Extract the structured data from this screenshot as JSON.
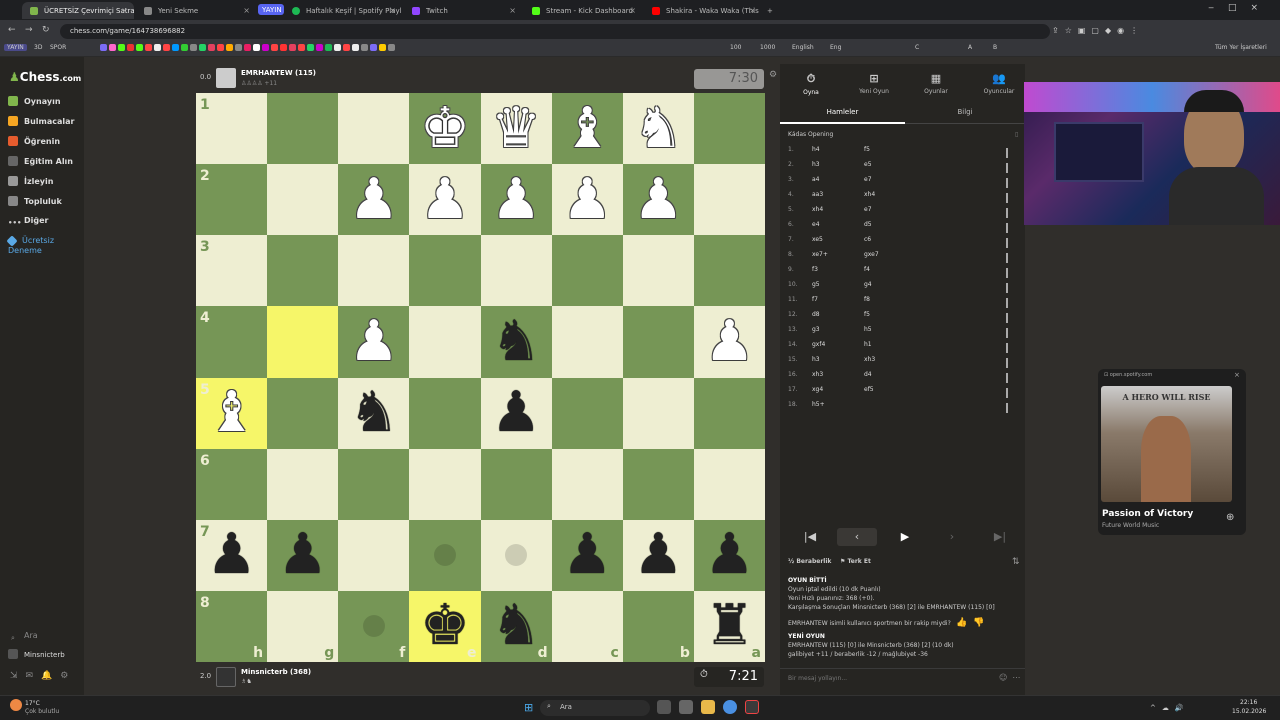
{
  "browser": {
    "tabs": [
      {
        "label": "ÜCRETSİZ Çevrimiçi Satran",
        "active": true
      },
      {
        "label": "Yeni Sekme"
      },
      {
        "label": "YAYIN"
      },
      {
        "label": "Haftalık Keşif | Spotify Playl"
      },
      {
        "label": "Twitch"
      },
      {
        "label": "Stream - Kick Dashboard"
      },
      {
        "label": "Shakira - Waka Waka (This"
      }
    ],
    "url": "chess.com/game/164738696882",
    "bookmarks": [
      "YAYIN",
      "3D",
      "SPOR",
      "100",
      "1000",
      "English",
      "Eng",
      "C",
      "A",
      "B",
      "Tüm Yer İşaretleri"
    ]
  },
  "sidebar": {
    "logo_main": "Chess",
    "logo_suffix": ".com",
    "items": [
      "Oynayın",
      "Bulmacalar",
      "Öğrenin",
      "Eğitim Alın",
      "İzleyin",
      "Topluluk",
      "Diğer",
      "Ücretsiz Deneme"
    ],
    "search": "Ara",
    "user": "Minsnicterb"
  },
  "top_player": {
    "score": "0.0",
    "name": "EMRHANTEW (115)",
    "clock": "7:30"
  },
  "bottom_player": {
    "score": "2.0",
    "name": "Minsnicterb (368)",
    "clock": "7:21"
  },
  "board": {
    "ranks": [
      "1",
      "2",
      "3",
      "4",
      "5",
      "6",
      "7",
      "8"
    ],
    "files": [
      "h",
      "g",
      "f",
      "e",
      "d",
      "c",
      "b",
      "a"
    ],
    "pieces": {
      "0-3": "♚",
      "0-4": "♛",
      "0-5": "♝",
      "0-6": "♞",
      "1-2": "♟",
      "1-3": "♟",
      "1-4": "♟",
      "1-5": "♟",
      "1-6": "♟",
      "3-2": "♟",
      "3-4": "♞",
      "3-7": "♟",
      "4-0": "♝",
      "4-2": "♞",
      "4-4": "♟",
      "6-0": "♟",
      "6-1": "♟",
      "6-5": "♟",
      "6-6": "♟",
      "6-7": "♟",
      "7-3": "♚",
      "7-4": "♞",
      "7-7": "♜"
    },
    "white_rows": [
      0,
      1,
      2,
      3
    ],
    "white_pieces": [
      "0-3",
      "0-4",
      "0-5",
      "0-6",
      "1-2",
      "1-3",
      "1-4",
      "1-5",
      "1-6",
      "3-2",
      "3-7",
      "4-0"
    ],
    "highlights": [
      "3-1",
      "4-0",
      "7-3"
    ],
    "dots": [
      "6-3",
      "6-4",
      "7-2"
    ]
  },
  "right_panel": {
    "tabs": [
      "Oyna",
      "Yeni Oyun",
      "Oyunlar",
      "Oyuncular"
    ],
    "subtabs": [
      "Hamleler",
      "Bilgi"
    ],
    "opening": "Kádas Opening",
    "moves": [
      [
        "1.",
        "h4",
        "f5"
      ],
      [
        "2.",
        "h3",
        "e5"
      ],
      [
        "3.",
        "a4",
        "e7"
      ],
      [
        "4.",
        "aa3",
        "xh4"
      ],
      [
        "5.",
        "xh4",
        "e7"
      ],
      [
        "6.",
        "e4",
        "d5"
      ],
      [
        "7.",
        "xe5",
        "c6"
      ],
      [
        "8.",
        "xe7+",
        "gxe7"
      ],
      [
        "9.",
        "f3",
        "f4"
      ],
      [
        "10.",
        "g5",
        "g4"
      ],
      [
        "11.",
        "f7",
        "f8"
      ],
      [
        "12.",
        "d8",
        "f5"
      ],
      [
        "13.",
        "g3",
        "h5"
      ],
      [
        "14.",
        "gxf4",
        "h1"
      ],
      [
        "15.",
        "h3",
        "xh3"
      ],
      [
        "16.",
        "xh3",
        "d4"
      ],
      [
        "17.",
        "xg4",
        "ef5"
      ],
      [
        "18.",
        "h5+",
        ""
      ]
    ],
    "draw_label": "Beraberlik",
    "resign_label": "Terk Et",
    "chat": [
      "OYUN BİTTİ",
      "Oyun iptal edildi (10 dk Puanlı)",
      "Yeni Hızlı puanınız: 368 (+0).",
      "Karşılaşma Sonuçları Minsnicterb (368) [2] ile EMRHANTEW (115) [0]",
      "EMRHANTEW isimli kullanıcı sportmen bir rakip miydi?",
      "YENİ OYUN",
      "EMRHANTEW (115) [0] ile Minsnicterb (368) [2] (10 dk)",
      "galibiyet +11 / beraberlik -12 / mağlubiyet -36"
    ],
    "chat_placeholder": "Bir mesaj yollayın..."
  },
  "spotify": {
    "source": "open.spotify.com",
    "cover_text": "A HERO WILL RISE",
    "title": "Passion of Victory",
    "artist": "Future World Music"
  },
  "taskbar": {
    "weather": "17°C",
    "weather_desc": "Çok bulutlu",
    "search": "Ara",
    "time": "22:16",
    "date": "15.02.2026"
  }
}
